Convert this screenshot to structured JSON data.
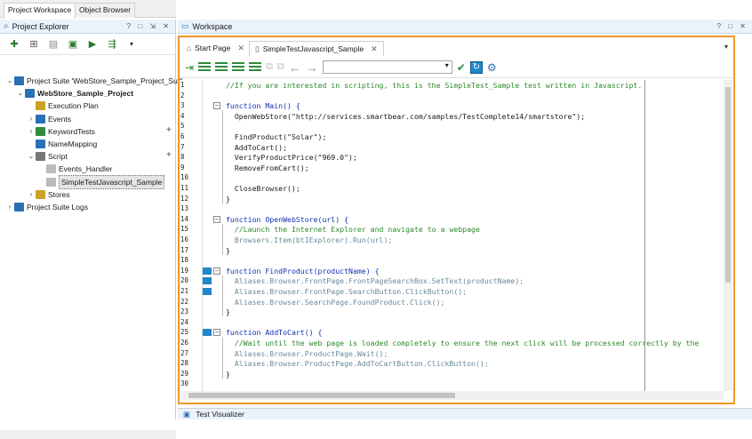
{
  "tabs_top": [
    "Project Workspace",
    "Object Browser"
  ],
  "left": {
    "title": "Project Explorer",
    "controls": "? □ ⇲ ✕",
    "tree": [
      {
        "label": "Project Suite 'WebStore_Sample_Project_Suit'",
        "indent": 0,
        "arrow": "⌄",
        "icon": "suite-icon"
      },
      {
        "label": "WebStore_Sample_Project",
        "indent": 1,
        "arrow": "⌄",
        "icon": "project-icon",
        "bold": true
      },
      {
        "label": "Execution Plan",
        "indent": 2,
        "arrow": "",
        "icon": "plan-icon"
      },
      {
        "label": "Events",
        "indent": 2,
        "arrow": "›",
        "icon": "events-icon"
      },
      {
        "label": "KeywordTests",
        "indent": 2,
        "arrow": "›",
        "icon": "keyword-icon",
        "plus": true
      },
      {
        "label": "NameMapping",
        "indent": 2,
        "arrow": "",
        "icon": "namemap-icon"
      },
      {
        "label": "Script",
        "indent": 2,
        "arrow": "⌄",
        "icon": "script-icon",
        "plus": true
      },
      {
        "label": "Events_Handler",
        "indent": 3,
        "arrow": "",
        "icon": "file-icon"
      },
      {
        "label": "SimpleTestJavascript_Sample",
        "indent": 3,
        "arrow": "",
        "icon": "file-icon",
        "selected": true
      },
      {
        "label": "Stores",
        "indent": 2,
        "arrow": "›",
        "icon": "stores-icon"
      },
      {
        "label": "Project Suite Logs",
        "indent": 0,
        "arrow": "›",
        "icon": "logs-icon"
      }
    ]
  },
  "workspace": {
    "title": "Workspace",
    "controls": "? □ ✕",
    "doc_tabs": [
      {
        "label": "Start Page"
      },
      {
        "label": "SimpleTestJavascript_Sample"
      }
    ],
    "combo_value": ""
  },
  "code": [
    {
      "n": "1",
      "t": "//If you are interested in scripting, this is the SimpleTest_Sample test written in Javascript.",
      "k": "cmt"
    },
    {
      "n": "2",
      "t": ""
    },
    {
      "n": "3",
      "t": "function Main() {",
      "k": "fn"
    },
    {
      "n": "4",
      "t": "  OpenWebStore(\"http://services.smartbear.com/samples/TestComplete14/smartstore\");",
      "k": "str"
    },
    {
      "n": "5",
      "t": ""
    },
    {
      "n": "6",
      "t": "  FindProduct(\"Solar\");",
      "k": "str"
    },
    {
      "n": "7",
      "t": "  AddToCart();"
    },
    {
      "n": "8",
      "t": "  VerifyProductPrice(\"969.0\");",
      "k": "str"
    },
    {
      "n": "9",
      "t": "  RemoveFromCart();"
    },
    {
      "n": "10",
      "t": ""
    },
    {
      "n": "11",
      "t": "  CloseBrowser();"
    },
    {
      "n": "12",
      "t": "}"
    },
    {
      "n": "13",
      "t": ""
    },
    {
      "n": "14",
      "t": "function OpenWebStore(url) {",
      "k": "fn"
    },
    {
      "n": "15",
      "t": "  //Launch the Internet Explorer and navigate to a webpage",
      "k": "cmt"
    },
    {
      "n": "16",
      "t": "  Browsers.Item(btIExplorer).Run(url);",
      "k": "alias"
    },
    {
      "n": "17",
      "t": "}"
    },
    {
      "n": "18",
      "t": ""
    },
    {
      "n": "19",
      "t": "function FindProduct(productName) {",
      "k": "fn"
    },
    {
      "n": "20",
      "t": "  Aliases.Browser.FrontPage.FrontPageSearchBox.SetText(productName);",
      "k": "alias"
    },
    {
      "n": "21",
      "t": "  Aliases.Browser.FrontPage.SearchButton.ClickButton();",
      "k": "alias"
    },
    {
      "n": "22",
      "t": "  Aliases.Browser.SearchPage.FoundProduct.Click();",
      "k": "alias"
    },
    {
      "n": "23",
      "t": "}"
    },
    {
      "n": "24",
      "t": ""
    },
    {
      "n": "25",
      "t": "function AddToCart() {",
      "k": "fn"
    },
    {
      "n": "26",
      "t": "  //Wait until the web page is loaded completely to ensure the next click will be processed correctly by the",
      "k": "cmt"
    },
    {
      "n": "27",
      "t": "  Aliases.Browser.ProductPage.Wait();",
      "k": "alias"
    },
    {
      "n": "28",
      "t": "  Aliases.Browser.ProductPage.AddToCartButton.ClickButton();",
      "k": "alias"
    },
    {
      "n": "29",
      "t": "}"
    },
    {
      "n": "30",
      "t": ""
    }
  ],
  "bottom": {
    "test_visualizer": "Test Visualizer"
  },
  "colors": {
    "accent": "#f0962a",
    "header_bg": "#eaf2fb",
    "marker": "#1e88c8"
  }
}
